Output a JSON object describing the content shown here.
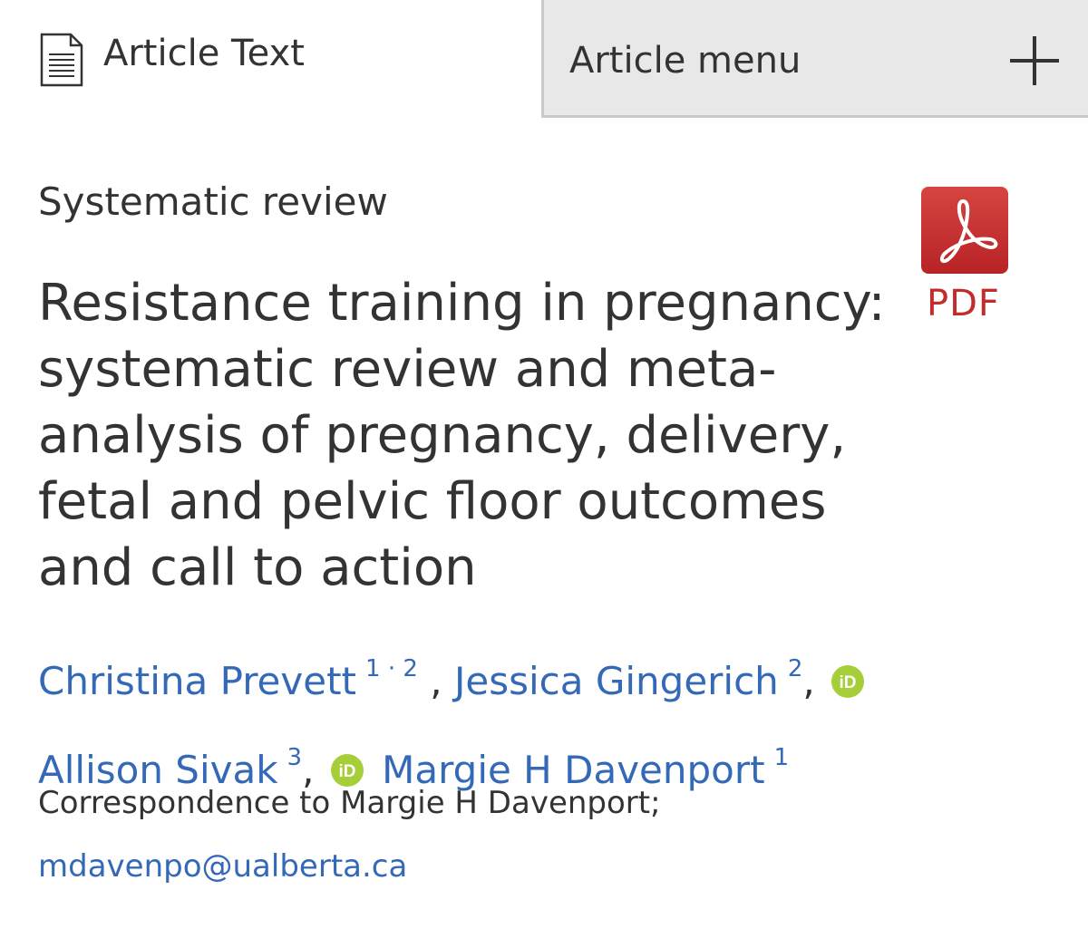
{
  "tabs": {
    "article_text": {
      "label": "Article Text",
      "icon": "document-icon"
    },
    "article_menu": {
      "label": "Article menu",
      "icon": "plus-icon"
    }
  },
  "article": {
    "type": "Systematic review",
    "title": "Resistance training in pregnancy: systematic review and meta-analysis of pregnancy, delivery, fetal and pelvic floor outcomes and call to action",
    "pdf_label": "PDF",
    "authors": [
      {
        "name": "Christina Prevett",
        "aff_a": "1",
        "aff_sep": "·",
        "aff_b": "2"
      },
      {
        "name": "Jessica Gingerich",
        "aff": "2"
      },
      {
        "name": "Allison Sivak",
        "aff": "3"
      },
      {
        "name": "Margie H Davenport",
        "aff": "1"
      }
    ],
    "correspondence": "Correspondence to Margie H Davenport;",
    "email": "mdavenpo@ualberta.ca"
  },
  "colors": {
    "link": "#3469b8",
    "text": "#333333",
    "pdf": "#c32c2c",
    "orcid": "#a6ce39",
    "menu_bg": "#e8e8e8"
  }
}
